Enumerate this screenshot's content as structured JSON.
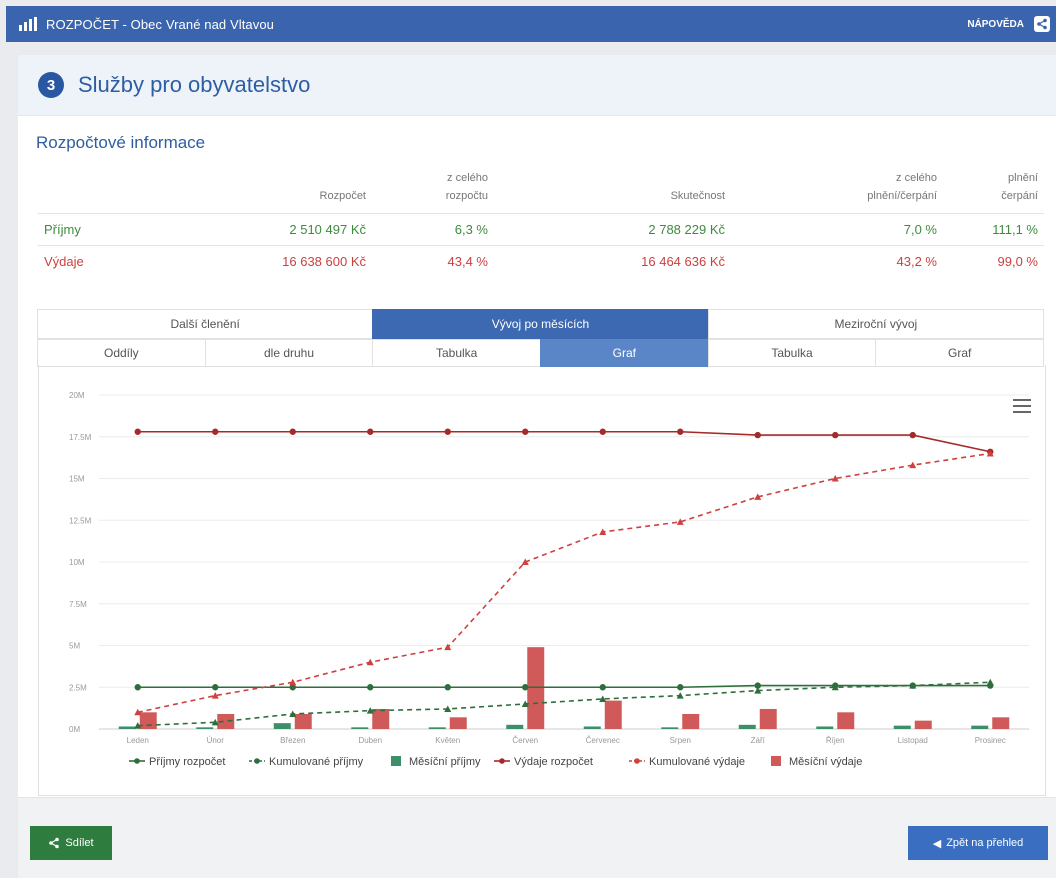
{
  "app": {
    "title": "ROZPOČET - Obec Vrané nad Vltavou",
    "help": "NÁPOVĚDA"
  },
  "section": {
    "number": "3",
    "title": "Služby pro obyvatelstvo"
  },
  "info": {
    "heading": "Rozpočtové informace",
    "columns": [
      "Rozpočet",
      "z celého rozpočtu",
      "Skutečnost",
      "z celého plnění/čerpání",
      "plnění čerpání"
    ],
    "rows": [
      {
        "label": "Příjmy",
        "values": [
          "2 510 497 Kč",
          "6,3 %",
          "2 788 229 Kč",
          "7,0 %",
          "111,1 %"
        ]
      },
      {
        "label": "Výdaje",
        "values": [
          "16 638 600 Kč",
          "43,4 %",
          "16 464 636 Kč",
          "43,2 %",
          "99,0 %"
        ]
      }
    ]
  },
  "tabs": {
    "row1": [
      "Další členění",
      "Vývoj po měsících",
      "Meziroční vývoj"
    ],
    "row2": [
      "Oddíly",
      "dle druhu",
      "Tabulka",
      "Graf",
      "Tabulka",
      "Graf"
    ]
  },
  "colors": {
    "green": "#2e6e3c",
    "red": "#a52a2a",
    "bar_green": "#3d8f6a",
    "bar_red": "#d05a5a",
    "accent": "#3a64ad"
  },
  "chart_data": {
    "type": "line",
    "x": [
      "Leden",
      "Únor",
      "Březen",
      "Duben",
      "Květen",
      "Červen",
      "Červenec",
      "Srpen",
      "Září",
      "Říjen",
      "Listopad",
      "Prosinec"
    ],
    "y_ticks": [
      "0M",
      "2.5M",
      "5M",
      "7.5M",
      "10M",
      "12.5M",
      "15M",
      "17.5M",
      "20M"
    ],
    "ylim": [
      0,
      20
    ],
    "series": [
      {
        "name": "Příjmy rozpočet",
        "values": [
          2.5,
          2.5,
          2.5,
          2.5,
          2.5,
          2.5,
          2.5,
          2.5,
          2.6,
          2.6,
          2.6,
          2.6
        ]
      },
      {
        "name": "Kumulované příjmy",
        "values": [
          0.2,
          0.4,
          0.9,
          1.1,
          1.2,
          1.5,
          1.8,
          2.0,
          2.3,
          2.5,
          2.6,
          2.8
        ]
      },
      {
        "name": "Měsíční příjmy",
        "values": [
          0.15,
          0.1,
          0.35,
          0.1,
          0.1,
          0.25,
          0.15,
          0.1,
          0.25,
          0.15,
          0.2,
          0.2
        ]
      },
      {
        "name": "Výdaje rozpočet",
        "values": [
          17.8,
          17.8,
          17.8,
          17.8,
          17.8,
          17.8,
          17.8,
          17.8,
          17.6,
          17.6,
          17.6,
          16.6
        ]
      },
      {
        "name": "Kumulované výdaje",
        "values": [
          1.0,
          2.0,
          2.8,
          4.0,
          4.9,
          10.0,
          11.8,
          12.4,
          13.9,
          15.0,
          15.8,
          16.5
        ]
      },
      {
        "name": "Měsíční výdaje",
        "values": [
          1.0,
          0.9,
          0.9,
          1.2,
          0.7,
          4.9,
          1.7,
          0.9,
          1.2,
          1.0,
          0.5,
          0.7
        ]
      }
    ]
  },
  "footer": {
    "share_label": "Sdílet",
    "back_label": "Zpět na přehled"
  }
}
